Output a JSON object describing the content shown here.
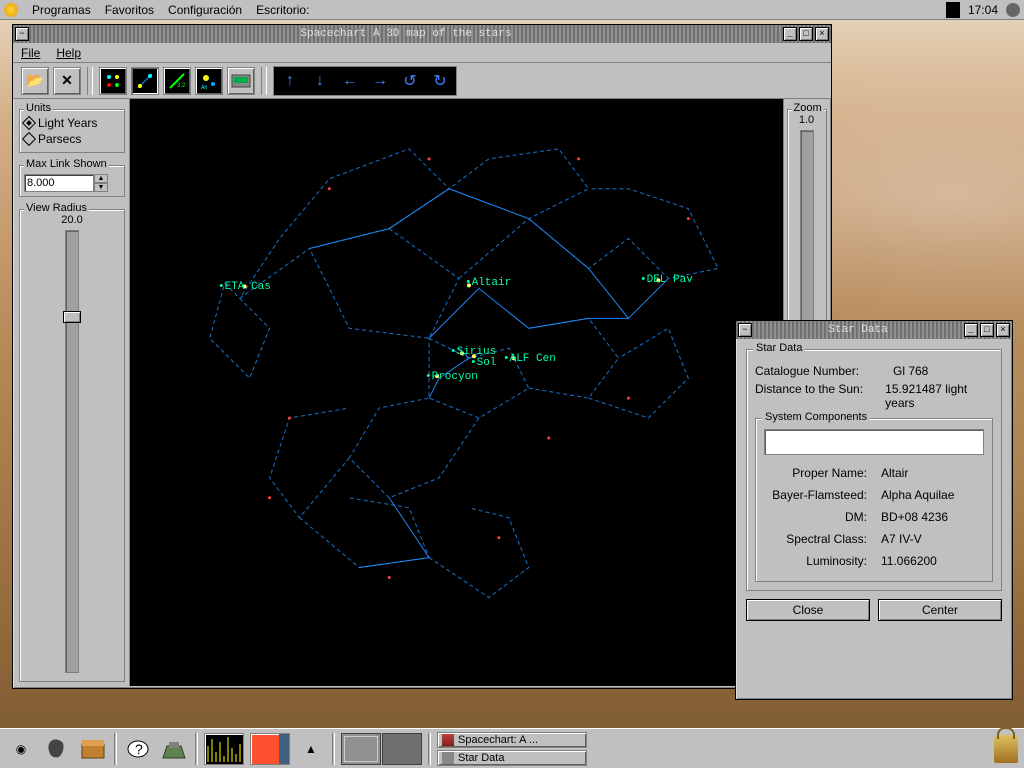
{
  "menubar": {
    "items": [
      "Programas",
      "Favoritos",
      "Configuración",
      "Escritorio:"
    ],
    "clock": "17:04"
  },
  "main_window": {
    "title": "Spacechart A 3D map of the stars",
    "menus": {
      "file": "File",
      "help": "Help"
    },
    "units": {
      "legend": "Units",
      "opt_ly": "Light Years",
      "opt_pc": "Parsecs"
    },
    "max_link": {
      "label": "Max Link Shown",
      "value": "8.000"
    },
    "view_radius": {
      "label": "View Radius",
      "value": "20.0"
    },
    "zoom": {
      "label": "Zoom",
      "value": "1.0"
    },
    "stars": {
      "eta_cas": "ETA Cas",
      "altair": "Altair",
      "del_pav": "DEL Pav",
      "sirius": "Sirius",
      "sol": "Sol",
      "alf_cen": "ALF Cen",
      "procyon": "Procyon"
    }
  },
  "star_data": {
    "title": "Star Data",
    "legend": "Star Data",
    "cat_label": "Catalogue Number:",
    "cat_value": "Gl 768",
    "dist_label": "Distance to the Sun:",
    "dist_value": "15.921487 light years",
    "components_legend": "System Components",
    "proper_name_l": "Proper Name:",
    "proper_name_v": "Altair",
    "bf_l": "Bayer-Flamsteed:",
    "bf_v": "Alpha Aquilae",
    "dm_l": "DM:",
    "dm_v": "BD+08  4236",
    "spec_l": "Spectral Class:",
    "spec_v": "A7 IV-V",
    "lum_l": "Luminosity:",
    "lum_v": "11.066200",
    "btn_close": "Close",
    "btn_center": "Center"
  },
  "taskbar": {
    "task1": "Spacechart: A ...",
    "task2": "Star Data"
  }
}
